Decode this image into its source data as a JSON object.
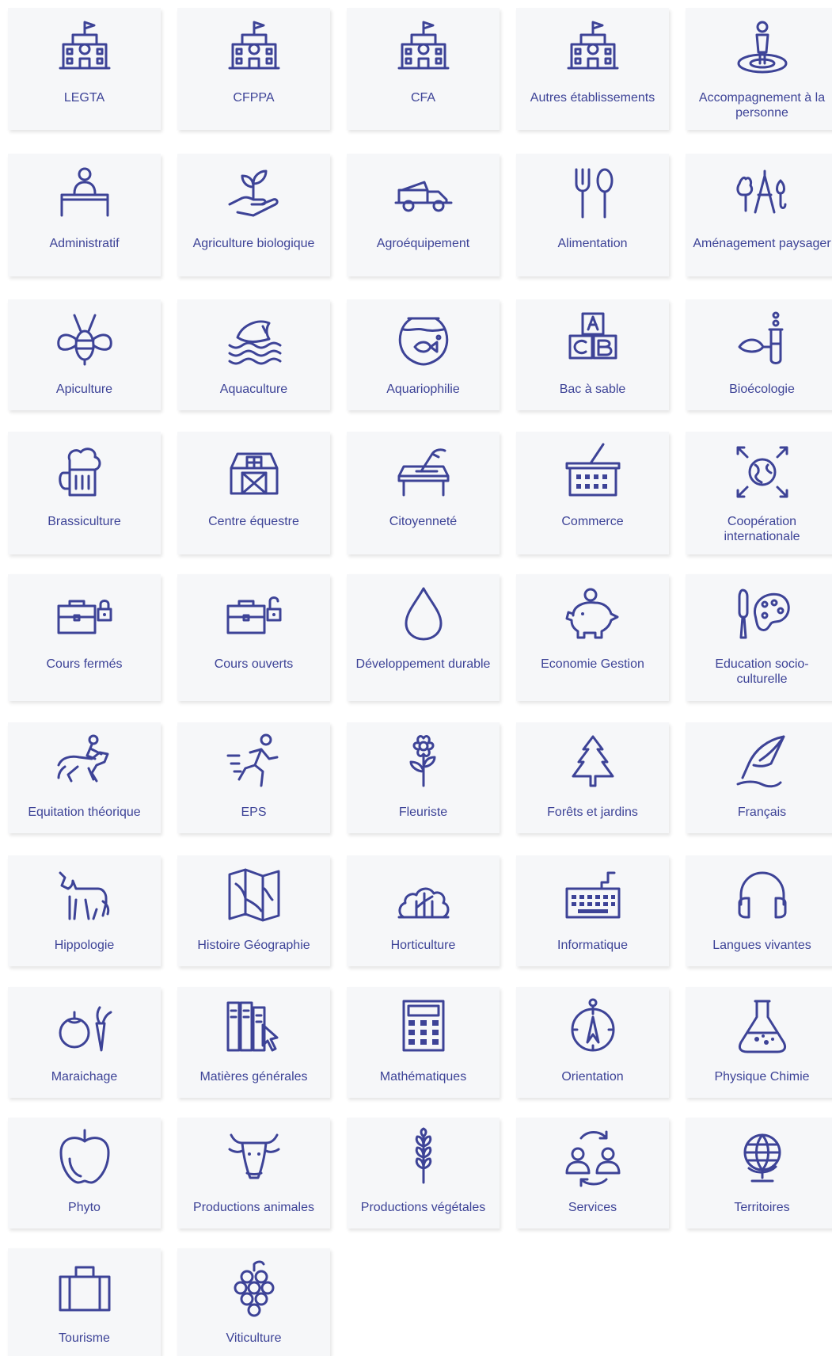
{
  "accent_color": "#3d4397",
  "tile_background": "#f6f7f9",
  "tiles": [
    {
      "label": "LEGTA",
      "icon": "school-building-icon"
    },
    {
      "label": "CFPPA",
      "icon": "school-building-icon"
    },
    {
      "label": "CFA",
      "icon": "school-building-icon"
    },
    {
      "label": "Autres établissements",
      "icon": "school-building-icon"
    },
    {
      "label": "Accompagnement à la personne",
      "icon": "person-on-target-icon"
    },
    {
      "label": "Administratif",
      "icon": "desk-clerk-icon"
    },
    {
      "label": "Agriculture biologique",
      "icon": "hand-sprout-icon"
    },
    {
      "label": "Agroéquipement",
      "icon": "dump-truck-icon"
    },
    {
      "label": "Alimentation",
      "icon": "fork-spoon-icon"
    },
    {
      "label": "Aménagement paysager",
      "icon": "trees-compass-icon"
    },
    {
      "label": "Apiculture",
      "icon": "bee-icon"
    },
    {
      "label": "Aquaculture",
      "icon": "fish-waves-icon"
    },
    {
      "label": "Aquariophilie",
      "icon": "fishbowl-icon"
    },
    {
      "label": "Bac à sable",
      "icon": "abc-blocks-icon"
    },
    {
      "label": "Bioécologie",
      "icon": "test-tube-leaf-icon"
    },
    {
      "label": "Brassiculture",
      "icon": "beer-mug-icon"
    },
    {
      "label": "Centre équestre",
      "icon": "barn-icon"
    },
    {
      "label": "Citoyenneté",
      "icon": "ballot-box-icon"
    },
    {
      "label": "Commerce",
      "icon": "shopping-basket-icon"
    },
    {
      "label": "Coopération internationale",
      "icon": "globe-arrows-icon"
    },
    {
      "label": "Cours fermés",
      "icon": "briefcase-locked-icon"
    },
    {
      "label": "Cours ouverts",
      "icon": "briefcase-unlocked-icon"
    },
    {
      "label": "Développement durable",
      "icon": "water-drop-icon"
    },
    {
      "label": "Economie Gestion",
      "icon": "piggy-bank-icon"
    },
    {
      "label": "Education socio-culturelle",
      "icon": "palette-brush-icon"
    },
    {
      "label": "Equitation théorique",
      "icon": "horse-rider-icon"
    },
    {
      "label": "EPS",
      "icon": "runner-icon"
    },
    {
      "label": "Fleuriste",
      "icon": "flower-icon"
    },
    {
      "label": "Forêts et jardins",
      "icon": "pine-tree-icon"
    },
    {
      "label": "Français",
      "icon": "quill-icon"
    },
    {
      "label": "Hippologie",
      "icon": "horse-icon"
    },
    {
      "label": "Histoire Géographie",
      "icon": "folded-map-icon"
    },
    {
      "label": "Horticulture",
      "icon": "bushes-icon"
    },
    {
      "label": "Informatique",
      "icon": "keyboard-icon"
    },
    {
      "label": "Langues vivantes",
      "icon": "headphones-icon"
    },
    {
      "label": "Maraichage",
      "icon": "tomato-carrot-icon"
    },
    {
      "label": "Matières générales",
      "icon": "binders-cursor-icon"
    },
    {
      "label": "Mathématiques",
      "icon": "calculator-icon"
    },
    {
      "label": "Orientation",
      "icon": "compass-icon"
    },
    {
      "label": "Physique Chimie",
      "icon": "flask-icon"
    },
    {
      "label": "Phyto",
      "icon": "apple-icon"
    },
    {
      "label": "Productions animales",
      "icon": "cow-head-icon"
    },
    {
      "label": "Productions végétales",
      "icon": "wheat-icon"
    },
    {
      "label": "Services",
      "icon": "people-exchange-icon"
    },
    {
      "label": "Territoires",
      "icon": "globe-stand-icon"
    },
    {
      "label": "Tourisme",
      "icon": "suitcase-icon"
    },
    {
      "label": "Viticulture",
      "icon": "grapes-icon"
    }
  ]
}
